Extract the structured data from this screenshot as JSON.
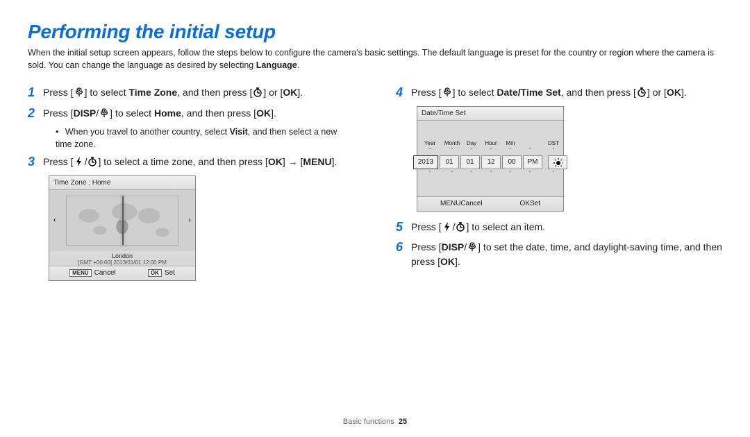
{
  "heading": "Performing the initial setup",
  "intro_a": "When the initial setup screen appears, follow the steps below to configure the camera's basic settings. The default language is preset for the country or region where the camera is sold. You can change the language as desired by selecting ",
  "intro_bold": "Language",
  "intro_b": ".",
  "step1_a": "Press [",
  "step1_b": "] to select ",
  "step1_bold": "Time Zone",
  "step1_c": ", and then press [",
  "step1_d": "] or [",
  "step1_e": "].",
  "step2_a": "Press [",
  "step2_b": "/",
  "step2_c": "] to select ",
  "step2_bold": "Home",
  "step2_d": ", and then press [",
  "step2_e": "].",
  "sub2_a": "When you travel to another country, select ",
  "sub2_bold": "Visit",
  "sub2_b": ", and then select a new time zone.",
  "step3_a": "Press [",
  "step3_b": "/",
  "step3_c": "] to select a time zone, and then press [",
  "step3_d": "] → [",
  "step3_e": "].",
  "step4_a": "Press [",
  "step4_b": "] to select ",
  "step4_bold": "Date/Time Set",
  "step4_c": ", and then press [",
  "step4_d": "] or [",
  "step4_e": "].",
  "step5_a": "Press [",
  "step5_b": "/",
  "step5_c": "] to select an item.",
  "step6_a": "Press [",
  "step6_b": "/",
  "step6_c": "] to set the date, time, and daylight-saving time, and then press [",
  "step6_d": "].",
  "icon_text": {
    "disp": "DISP",
    "menu": "MENU",
    "ok": "OK"
  },
  "tz_screen": {
    "title": "Time Zone : Home",
    "city": "London",
    "meta": "[GMT +00:00] 2013/01/01 12:00 PM",
    "cancel": "Cancel",
    "set": "Set"
  },
  "dt_screen": {
    "title": "Date/Time Set",
    "labels": {
      "year": "Year",
      "month": "Month",
      "day": "Day",
      "hour": "Hour",
      "min": "Min",
      "dst": "DST"
    },
    "values": {
      "year": "2013",
      "month": "01",
      "day": "01",
      "hour": "12",
      "min": "00",
      "ampm": "PM"
    },
    "cancel": "Cancel",
    "set": "Set"
  },
  "footer_section": "Basic functions",
  "footer_page": "25"
}
